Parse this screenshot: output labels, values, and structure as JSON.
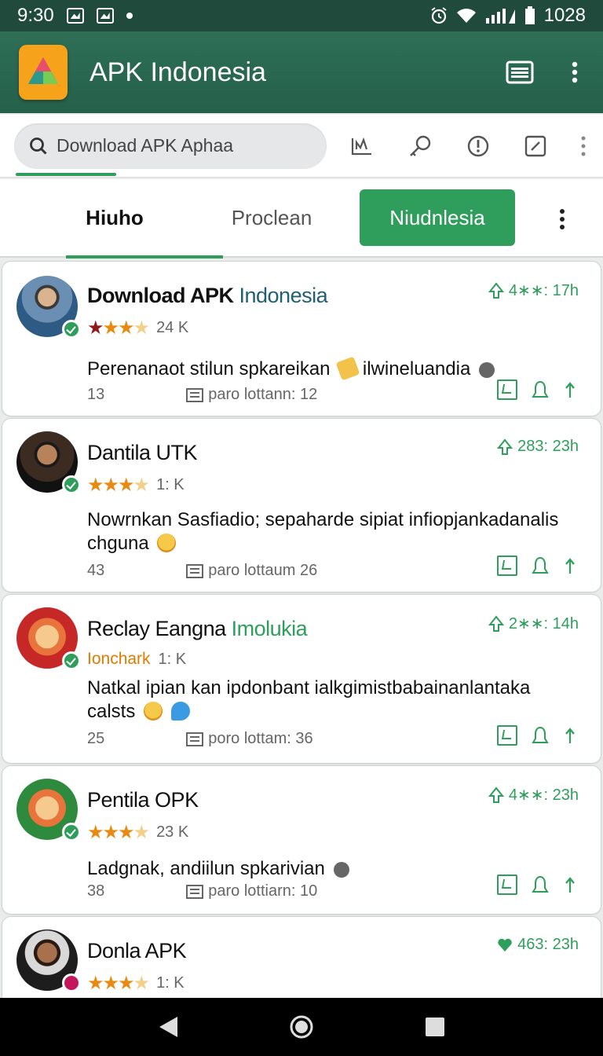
{
  "status": {
    "time": "9:30",
    "battery_text": "1028"
  },
  "appbar": {
    "title": "APK Indonesia"
  },
  "search": {
    "value": "Download APK Aphaa"
  },
  "tabs": [
    {
      "label": "Hiuho"
    },
    {
      "label": "Proclean"
    },
    {
      "label": "Niudnlesia"
    }
  ],
  "colors": {
    "primary": "#2f9e5c",
    "appbar": "#2e6f56",
    "star": "#e88a12"
  },
  "cards": [
    {
      "name": "Download APK ",
      "name_accent": "Indonesia",
      "accent_color": "#1e5f74",
      "rating_count": "24 K",
      "meta": "4∗∗: 17h",
      "desc": "Perenanaot stilun spkareikan",
      "desc_tail": "ilwineluandia",
      "comments": "13",
      "downloads": "paro lottann: 12"
    },
    {
      "name": "Dantila UTK",
      "rating_count": "1: K",
      "meta": "283: 23h",
      "desc": "Nowrnkan Sasfiadio; sepaharde sipiat infiopjankadanalis chguna",
      "comments": "43",
      "downloads": "paro lottaum 26"
    },
    {
      "name": "Reclay Eangna ",
      "name_accent": "Imolukia",
      "accent_color": "#2f9e5c",
      "developer": "Ionchark",
      "rating_count": "1: K",
      "meta": "2∗∗: 14h",
      "desc": "Natkal ipian kan ipdonbant ialkgimistbabainanlantaka calsts",
      "comments": "25",
      "downloads": "poro lottam: 36"
    },
    {
      "name": "Pentila OPK",
      "rating_count": "23 K",
      "meta": "4∗∗: 23h",
      "desc": "Ladgnak, andiilun spkarivian",
      "comments": "38",
      "downloads": "paro lottiarn: 10"
    },
    {
      "name": "Donla APK",
      "rating_count": "1: K",
      "meta": "463: 23h"
    }
  ]
}
